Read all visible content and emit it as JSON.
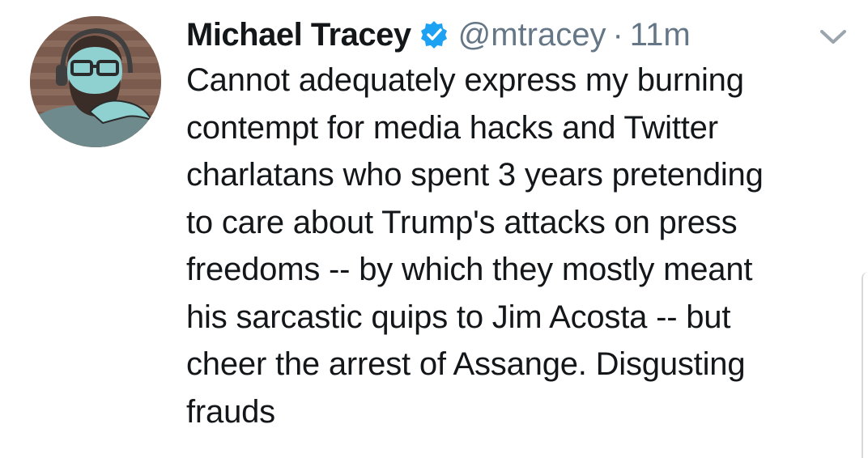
{
  "author": {
    "display_name": "Michael Tracey",
    "handle": "@mtracey",
    "verified": true,
    "verified_icon": "verified-badge-icon",
    "avatar_icon": "bearded-man-with-glasses-illustration"
  },
  "meta": {
    "separator": "·",
    "timestamp": "11m"
  },
  "menu_icon": "chevron-down-icon",
  "tweet": {
    "text": "Cannot adequately express my burning\ncontempt for media hacks and Twitter\ncharlatans who spent 3 years pretending\nto care about Trump's attacks on press\nfreedoms -- by which they mostly meant\nhis sarcastic quips to Jim Acosta -- but\ncheer the arrest of Assange. Disgusting\nfrauds"
  },
  "colors": {
    "text": "#14171a",
    "secondary": "#657786",
    "verified_blue": "#1da1f2"
  }
}
